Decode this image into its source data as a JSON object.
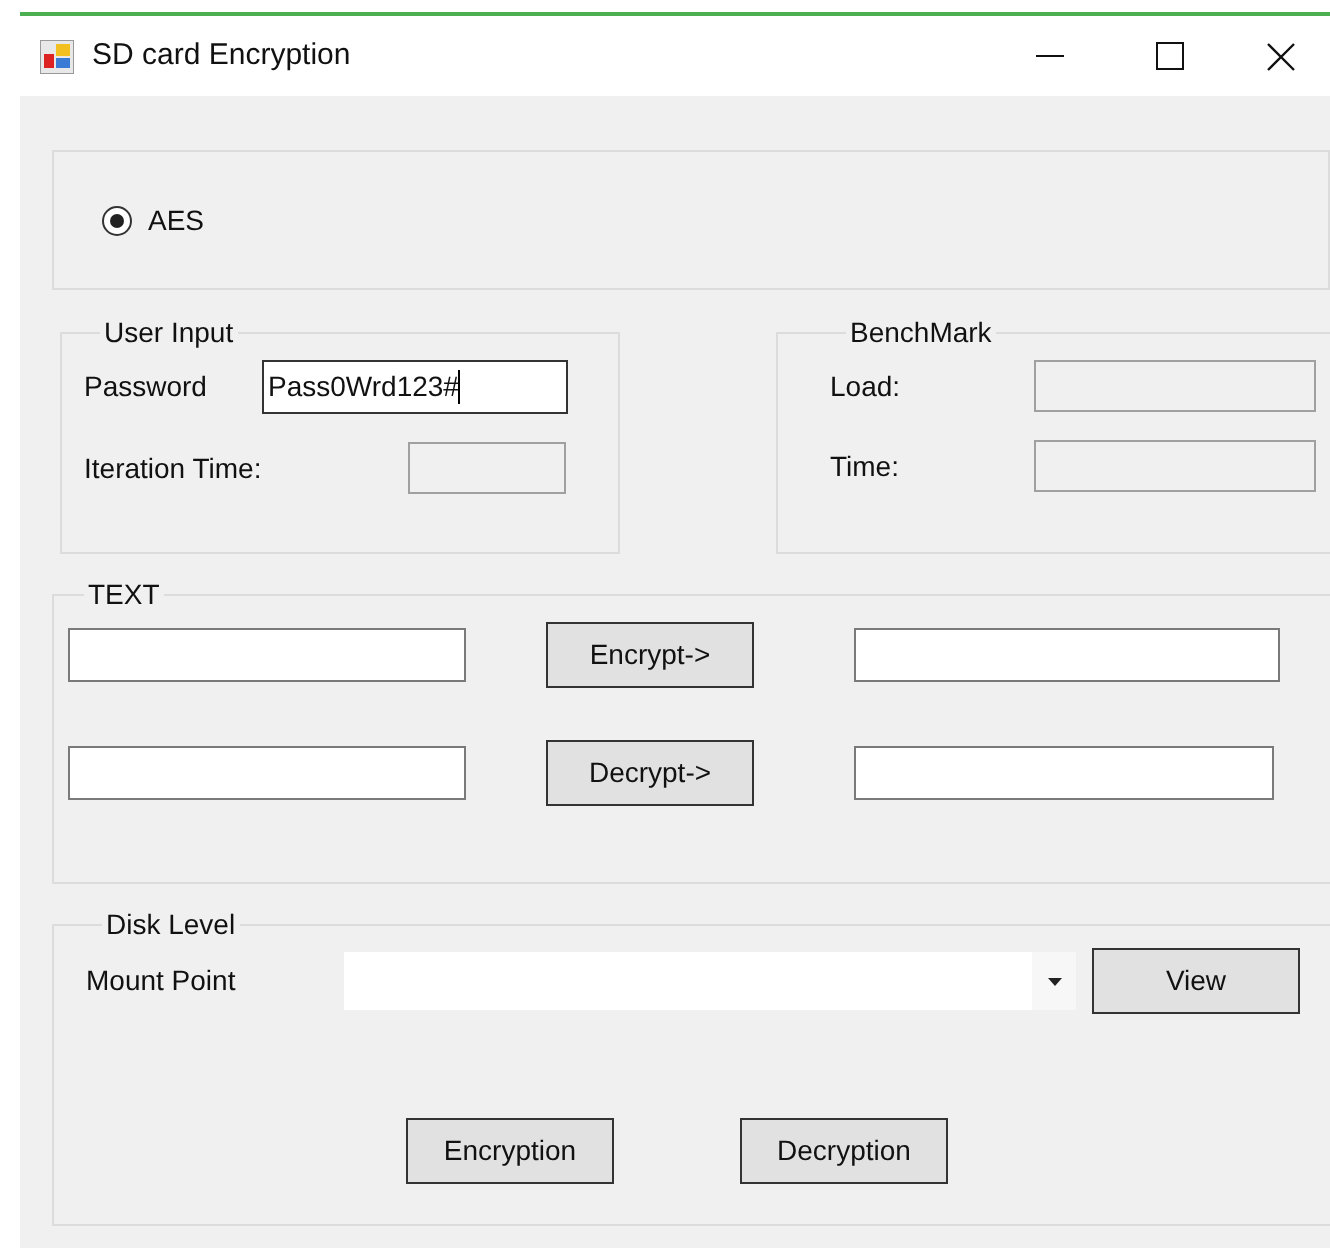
{
  "window": {
    "title": "SD card Encryption"
  },
  "algorithm": {
    "options": [
      {
        "label": "AES",
        "selected": true
      }
    ]
  },
  "user_input": {
    "title": "User Input",
    "password": {
      "label": "Password",
      "value": "Pass0Wrd123#",
      "focused": true
    },
    "iteration_time": {
      "label": "Iteration Time:"
    }
  },
  "benchmark": {
    "title": "BenchMark",
    "fields": [
      {
        "label": "Load:"
      },
      {
        "label": "Time:"
      }
    ]
  },
  "text": {
    "title": "TEXT",
    "rows": [
      {
        "button": "Encrypt->"
      },
      {
        "button": "Decrypt->"
      }
    ]
  },
  "disk_level": {
    "title": "Disk Level",
    "mount_point_label": "Mount Point",
    "view_button": "View",
    "buttons": [
      "Encryption",
      "Decryption"
    ]
  }
}
